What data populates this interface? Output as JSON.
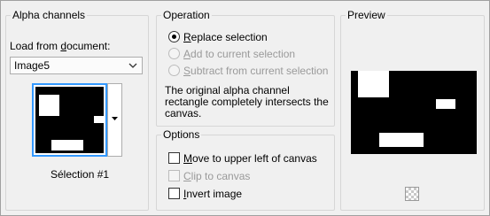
{
  "alpha_channels": {
    "title": "Alpha channels",
    "load_from_label_prefix": "Load from ",
    "load_from_label_underlined": "d",
    "load_from_label_suffix": "ocument:",
    "document_value": "Image5",
    "thumbnail_caption": "Sélection #1"
  },
  "operation": {
    "title": "Operation",
    "options": [
      {
        "label_underlined": "R",
        "label_rest": "eplace selection",
        "selected": true,
        "enabled": true
      },
      {
        "label_underlined": "A",
        "label_rest": "dd to current selection",
        "selected": false,
        "enabled": false
      },
      {
        "label_underlined": "S",
        "label_rest": "ubtract from current selection",
        "selected": false,
        "enabled": false
      }
    ],
    "description_line1": "The original alpha channel",
    "description_line2": "rectangle completely intersects the",
    "description_line3": "canvas."
  },
  "options": {
    "title": "Options",
    "checkboxes": [
      {
        "label_underlined": "M",
        "label_rest": "ove to upper left of canvas",
        "checked": false,
        "enabled": true
      },
      {
        "label_underlined": "C",
        "label_rest": "lip to canvas",
        "checked": false,
        "enabled": false
      },
      {
        "label_underlined": "I",
        "label_rest": "nvert image",
        "checked": false,
        "enabled": true
      }
    ]
  },
  "preview": {
    "title": "Preview"
  },
  "colors": {
    "selection_border": "#3399ff",
    "disabled_text": "#9a9a9a",
    "panel_bg": "#f0f0f0"
  }
}
